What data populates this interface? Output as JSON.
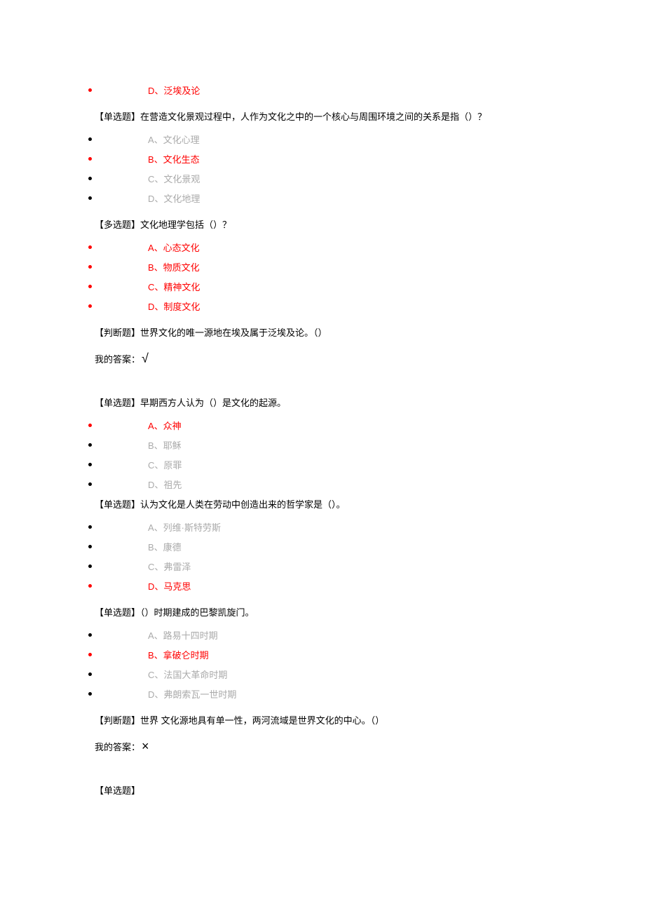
{
  "items": [
    {
      "kind": "option",
      "color": "red",
      "bullet": "red",
      "text": "D、泛埃及论"
    },
    {
      "kind": "question",
      "text": "【单选题】在营造文化景观过程中，人作为文化之中的一个核心与周围环境之间的关系是指（）？"
    },
    {
      "kind": "option",
      "color": "gray",
      "bullet": "black",
      "text": "A、文化心理"
    },
    {
      "kind": "option",
      "color": "red",
      "bullet": "red",
      "text": "B、文化生态"
    },
    {
      "kind": "option",
      "color": "gray",
      "bullet": "black",
      "text": "C、文化景观"
    },
    {
      "kind": "option",
      "color": "gray",
      "bullet": "black",
      "text": "D、文化地理"
    },
    {
      "kind": "question",
      "text": "【多选题】文化地理学包括（）？"
    },
    {
      "kind": "option",
      "color": "red",
      "bullet": "red",
      "text": "A、心态文化"
    },
    {
      "kind": "option",
      "color": "red",
      "bullet": "red",
      "text": "B、物质文化"
    },
    {
      "kind": "option",
      "color": "red",
      "bullet": "red",
      "text": "C、精神文化"
    },
    {
      "kind": "option",
      "color": "red",
      "bullet": "red",
      "text": "D、制度文化"
    },
    {
      "kind": "question",
      "text": "【判断题】世界文化的唯一源地在埃及属于泛埃及论。（）"
    },
    {
      "kind": "answer",
      "label": "我的答案：",
      "symbol": "√"
    },
    {
      "kind": "spacer"
    },
    {
      "kind": "question",
      "text": "【单选题】早期西方人认为（）是文化的起源。"
    },
    {
      "kind": "option",
      "color": "red",
      "bullet": "red",
      "text": "A、众神"
    },
    {
      "kind": "option",
      "color": "gray",
      "bullet": "black",
      "text": "B、耶稣"
    },
    {
      "kind": "option",
      "color": "gray",
      "bullet": "black",
      "text": "C、原罪"
    },
    {
      "kind": "option",
      "color": "gray",
      "bullet": "black",
      "text": "D、祖先"
    },
    {
      "kind": "question-tight",
      "text": "【单选题】认为文化是人类在劳动中创造出来的哲学家是（）。"
    },
    {
      "kind": "option",
      "color": "gray",
      "bullet": "black",
      "text": "A、列维·斯特劳斯"
    },
    {
      "kind": "option",
      "color": "gray",
      "bullet": "black",
      "text": "B、康德"
    },
    {
      "kind": "option",
      "color": "gray",
      "bullet": "black",
      "text": "C、弗雷泽"
    },
    {
      "kind": "option",
      "color": "red",
      "bullet": "red",
      "text": "D、马克思"
    },
    {
      "kind": "question",
      "text": "【单选题】（）时期建成的巴黎凯旋门。"
    },
    {
      "kind": "option",
      "color": "gray",
      "bullet": "black",
      "text": "A、路易十四时期"
    },
    {
      "kind": "option",
      "color": "red",
      "bullet": "red",
      "text": "B、拿破仑时期"
    },
    {
      "kind": "option",
      "color": "gray",
      "bullet": "black",
      "text": "C、法国大革命时期"
    },
    {
      "kind": "option",
      "color": "gray",
      "bullet": "black",
      "text": "D、弗朗索瓦一世时期"
    },
    {
      "kind": "question",
      "text": "【判断题】世界 文化源地具有单一性，两河流域是世界文化的中心。（）"
    },
    {
      "kind": "answer",
      "label": "我的答案：",
      "symbol": "×"
    },
    {
      "kind": "spacer"
    },
    {
      "kind": "question",
      "text": "【单选题】"
    }
  ]
}
